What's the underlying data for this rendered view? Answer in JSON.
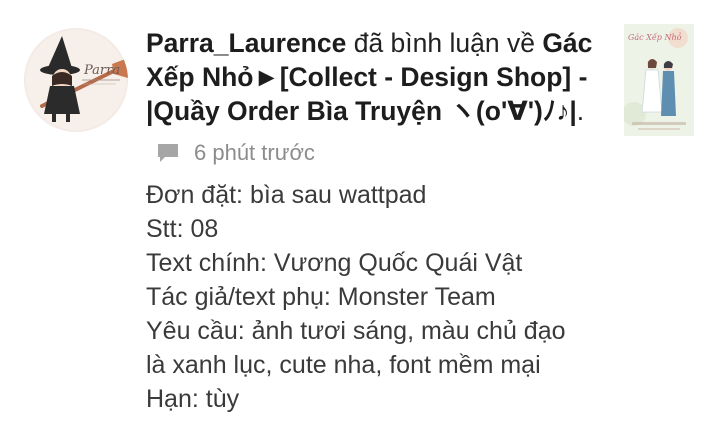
{
  "notification": {
    "user": "Parra_Laurence",
    "action": " đã bình luận về ",
    "story_title": "Gác Xếp Nhỏ►[Collect - Design Shop] - |Quầy Order Bìa Truyện ヽ(o'∀')ﾉ♪|",
    "end_punct": ".",
    "time": "6 phút trước",
    "avatar_text": "Parra",
    "cover_title": "Gác Xếp Nhỏ"
  },
  "comment": {
    "lines": [
      "Đơn đặt: bìa sau wattpad",
      "Stt: 08",
      "Text chính: Vương Quốc Quái Vật",
      "Tác giả/text phụ: Monster Team",
      "Yêu cầu: ảnh tươi sáng, màu chủ đạo",
      "là xanh lục, cute nha, font mềm mại",
      "Hạn: tùy"
    ]
  },
  "icons": {
    "comment": "comment-bubble-icon"
  },
  "colors": {
    "text_primary": "#222222",
    "text_body": "#3a3a3a",
    "meta_gray": "#8c8c8c"
  }
}
